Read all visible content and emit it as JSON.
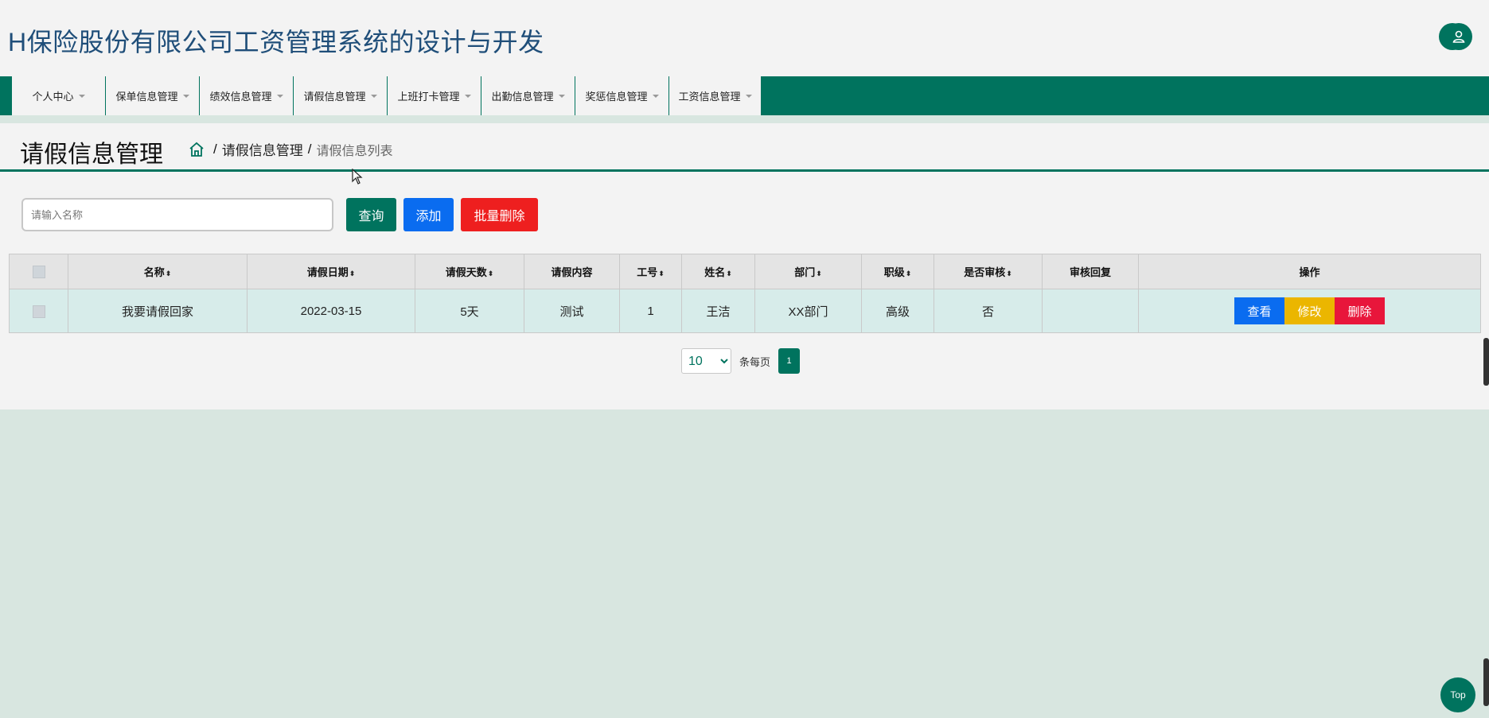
{
  "header": {
    "title": "H保险股份有限公司工资管理系统的设计与开发",
    "fullscreen_icon": "fullscreen-icon",
    "user_icon": "user-icon"
  },
  "nav": {
    "items": [
      {
        "label": "个人中心"
      },
      {
        "label": "保单信息管理"
      },
      {
        "label": "绩效信息管理"
      },
      {
        "label": "请假信息管理"
      },
      {
        "label": "上班打卡管理"
      },
      {
        "label": "出勤信息管理"
      },
      {
        "label": "奖惩信息管理"
      },
      {
        "label": "工资信息管理"
      }
    ]
  },
  "page": {
    "title": "请假信息管理",
    "breadcrumb": {
      "home_icon": "home-icon",
      "sep1": "/",
      "section": "请假信息管理",
      "sep2": "/",
      "current": "请假信息列表"
    }
  },
  "toolbar": {
    "search_placeholder": "请输入名称",
    "search_value": "",
    "query_label": "查询",
    "add_label": "添加",
    "batch_delete_label": "批量删除"
  },
  "table": {
    "sort_glyph": "⬍",
    "headers": {
      "name": "名称",
      "date": "请假日期",
      "days": "请假天数",
      "content": "请假内容",
      "emp_no": "工号",
      "emp_name": "姓名",
      "dept": "部门",
      "level": "职级",
      "reviewed": "是否审核",
      "reply": "审核回复",
      "actions": "操作"
    },
    "rows": [
      {
        "name": "我要请假回家",
        "date": "2022-03-15",
        "days": "5天",
        "content": "测试",
        "emp_no": "1",
        "emp_name": "王洁",
        "dept": "XX部门",
        "level": "高级",
        "reviewed": "否",
        "reply": "",
        "view_label": "查看",
        "edit_label": "修改",
        "delete_label": "删除"
      }
    ]
  },
  "pagination": {
    "page_size": "10",
    "page_size_options": [
      "10"
    ],
    "per_page_label": "条每页",
    "current_page": "1"
  },
  "back_to_top": "Top",
  "colors": {
    "primary": "#00735e",
    "blue": "#0a6cf0",
    "red": "#ee1f1f",
    "yellow": "#ebb600",
    "title_blue": "#1f4e79"
  }
}
